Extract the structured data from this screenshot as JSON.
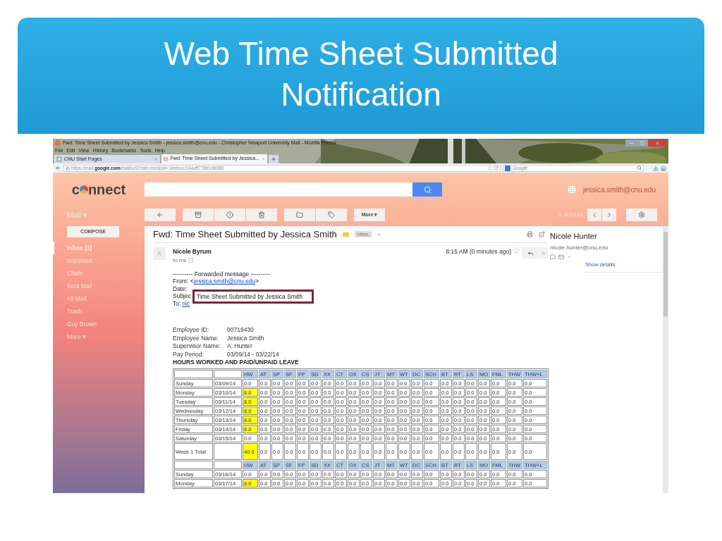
{
  "slide": {
    "title": "Web Time Sheet Submitted Notification"
  },
  "browser": {
    "window_title": "Fwd: Time Sheet Submitted by Jessica Smith - jessica.smith@cnu.edu - Christopher Newport University Mail - Mozilla Firefox",
    "menu": [
      "File",
      "Edit",
      "View",
      "History",
      "Bookmarks",
      "Tools",
      "Help"
    ],
    "tabs": [
      {
        "label": "CNU Start Pages",
        "selected": false
      },
      {
        "label": "Fwd: Time Sheet Submitted by Jessica...",
        "selected": true
      }
    ],
    "url": {
      "prefix": "https://mail.",
      "domain": "google.com",
      "path": "/mail/u/0/?tab=mm&pli=1#inbox/144cff778d1d0080"
    },
    "search_engine": "Google"
  },
  "mail": {
    "logo_start": "c",
    "logo_end": "nnect",
    "account": "jessica.smith@cnu.edu",
    "section": "Mail ▾",
    "compose": "COMPOSE",
    "folders": [
      {
        "label": "Inbox (1)",
        "selected": true
      },
      {
        "label": "Important",
        "selected": false
      },
      {
        "label": "Chats",
        "selected": false
      },
      {
        "label": "Sent Mail",
        "selected": false
      },
      {
        "label": "All Mail",
        "selected": false
      },
      {
        "label": "Trash",
        "selected": false
      },
      {
        "label": "Guy Brown",
        "selected": false
      },
      {
        "label": "More ▾",
        "selected": false
      }
    ],
    "more_button": "More ▾",
    "count": "1 of 9,112"
  },
  "message": {
    "subject": "Fwd: Time Sheet Submitted by Jessica Smith",
    "label": "Inbox",
    "sender": "Nicole Byrum",
    "recipient": "to me",
    "time": "8:15 AM (0 minutes ago)",
    "forward_header": "---------- Forwarded message ----------",
    "from_label": "From: <",
    "from_email": "jessica.smith@cnu.edu",
    "from_end": ">",
    "date_label": "Date:",
    "subject_label": "Subjec",
    "to_label": "To:",
    "to_email": "nic",
    "callout": "Time Sheet Submitted by Jessica Smith",
    "details": [
      {
        "label": "Employee ID:",
        "value": "00719430"
      },
      {
        "label": "Employee Name:",
        "value": "Jessica Smith"
      },
      {
        "label": "Supervisor Name:",
        "value": "A. Hunter"
      },
      {
        "label": "Pay Period:",
        "value": "03/09/14 - 03/22/14"
      }
    ],
    "section_title": "HOURS WORKED AND PAID/UNPAID LEAVE"
  },
  "contact": {
    "name": "Nicole Hunter",
    "email": "nicole.hunter@cnu.edu",
    "link": "Show details"
  },
  "timesheet": {
    "rows": [
      {
        "kind": "header",
        "columns": [
          "HW",
          "AT",
          "SP",
          "SF",
          "FP",
          "SD",
          "XX",
          "CT",
          "OX",
          "CS",
          "JT",
          "MT",
          "WT",
          "DC",
          "SCH",
          "BT",
          "RT",
          "LS",
          "MO",
          "FML",
          "THW",
          "THW+L"
        ]
      },
      {
        "kind": "day",
        "day": "Sunday",
        "date": "03/09/14",
        "hw_highlighted": false,
        "values": [
          "0.0",
          "0.0",
          "0.0",
          "0.0",
          "0.0",
          "0.0",
          "0.0",
          "0.0",
          "0.0",
          "0.0",
          "0.0",
          "0.0",
          "0.0",
          "0.0",
          "0.0",
          "0.0",
          "0.0",
          "0.0",
          "0.0",
          "0.0",
          "0.0",
          "0.0"
        ]
      },
      {
        "kind": "day",
        "day": "Monday",
        "date": "03/10/14",
        "hw_highlighted": true,
        "values": [
          "8.0",
          "0.0",
          "0.0",
          "0.0",
          "0.0",
          "0.0",
          "0.0",
          "0.0",
          "0.0",
          "0.0",
          "0.0",
          "0.0",
          "0.0",
          "0.0",
          "0.0",
          "0.0",
          "0.0",
          "0.0",
          "0.0",
          "0.0",
          "0.0",
          "0.0"
        ]
      },
      {
        "kind": "day",
        "day": "Tuesday",
        "date": "03/11/14",
        "hw_highlighted": true,
        "values": [
          "8.0",
          "0.0",
          "0.0",
          "0.0",
          "0.0",
          "0.0",
          "0.0",
          "0.0",
          "0.0",
          "0.0",
          "0.0",
          "0.0",
          "0.0",
          "0.0",
          "0.0",
          "0.0",
          "0.0",
          "0.0",
          "0.0",
          "0.0",
          "0.0",
          "0.0"
        ]
      },
      {
        "kind": "day",
        "day": "Wednesday",
        "date": "03/12/14",
        "hw_highlighted": true,
        "values": [
          "8.0",
          "0.0",
          "0.0",
          "0.0",
          "0.0",
          "0.0",
          "0.0",
          "0.0",
          "0.0",
          "0.0",
          "0.0",
          "0.0",
          "0.0",
          "0.0",
          "0.0",
          "0.0",
          "0.0",
          "0.0",
          "0.0",
          "0.0",
          "0.0",
          "0.0"
        ]
      },
      {
        "kind": "day",
        "day": "Thursday",
        "date": "03/13/14",
        "hw_highlighted": true,
        "values": [
          "8.0",
          "0.0",
          "0.0",
          "0.0",
          "0.0",
          "0.0",
          "0.0",
          "0.0",
          "0.0",
          "0.0",
          "0.0",
          "0.0",
          "0.0",
          "0.0",
          "0.0",
          "0.0",
          "0.0",
          "0.0",
          "0.0",
          "0.0",
          "0.0",
          "0.0"
        ]
      },
      {
        "kind": "day",
        "day": "Friday",
        "date": "03/14/14",
        "hw_highlighted": true,
        "values": [
          "8.0",
          "0.0",
          "0.0",
          "0.0",
          "0.0",
          "0.0",
          "0.0",
          "0.0",
          "0.0",
          "0.0",
          "0.0",
          "0.0",
          "0.0",
          "0.0",
          "0.0",
          "0.0",
          "0.0",
          "0.0",
          "0.0",
          "0.0",
          "0.0",
          "0.0"
        ]
      },
      {
        "kind": "day",
        "day": "Saturday",
        "date": "03/15/14",
        "hw_highlighted": false,
        "values": [
          "0.0",
          "0.0",
          "0.0",
          "0.0",
          "0.0",
          "0.0",
          "0.0",
          "0.0",
          "0.0",
          "0.0",
          "0.0",
          "0.0",
          "0.0",
          "0.0",
          "0.0",
          "0.0",
          "0.0",
          "0.0",
          "0.0",
          "0.0",
          "0.0",
          "0.0"
        ]
      },
      {
        "kind": "total",
        "day": "Week 1 Total",
        "hw_highlighted": true,
        "values": [
          "40.0",
          "0.0",
          "0.0",
          "0.0",
          "0.0",
          "0.0",
          "0.0",
          "0.0",
          "0.0",
          "0.0",
          "0.0",
          "0.0",
          "0.0",
          "0.0",
          "0.0",
          "0.0",
          "0.0",
          "0.0",
          "0.0",
          "0.0",
          "0.0",
          "0.0"
        ]
      },
      {
        "kind": "header",
        "columns": [
          "HW",
          "AT",
          "SP",
          "SF",
          "FP",
          "SD",
          "XX",
          "CT",
          "OX",
          "CS",
          "JT",
          "MT",
          "WT",
          "DC",
          "SCH",
          "BT",
          "RT",
          "LS",
          "MO",
          "FML",
          "THW",
          "THW+L"
        ]
      },
      {
        "kind": "day",
        "day": "Sunday",
        "date": "03/16/14",
        "hw_highlighted": false,
        "values": [
          "0.0",
          "0.0",
          "0.0",
          "0.0",
          "0.0",
          "0.0",
          "0.0",
          "0.0",
          "0.0",
          "0.0",
          "0.0",
          "0.0",
          "0.0",
          "0.0",
          "0.0",
          "0.0",
          "0.0",
          "0.0",
          "0.0",
          "0.0",
          "0.0",
          "0.0"
        ]
      },
      {
        "kind": "day",
        "day": "Monday",
        "date": "03/17/14",
        "hw_highlighted": true,
        "values": [
          "8.0",
          "0.0",
          "0.0",
          "0.0",
          "0.0",
          "0.0",
          "0.0",
          "0.0",
          "0.0",
          "0.0",
          "0.0",
          "0.0",
          "0.0",
          "0.0",
          "0.0",
          "0.0",
          "0.0",
          "0.0",
          "0.0",
          "0.0",
          "0.0",
          "0.0"
        ]
      }
    ]
  }
}
